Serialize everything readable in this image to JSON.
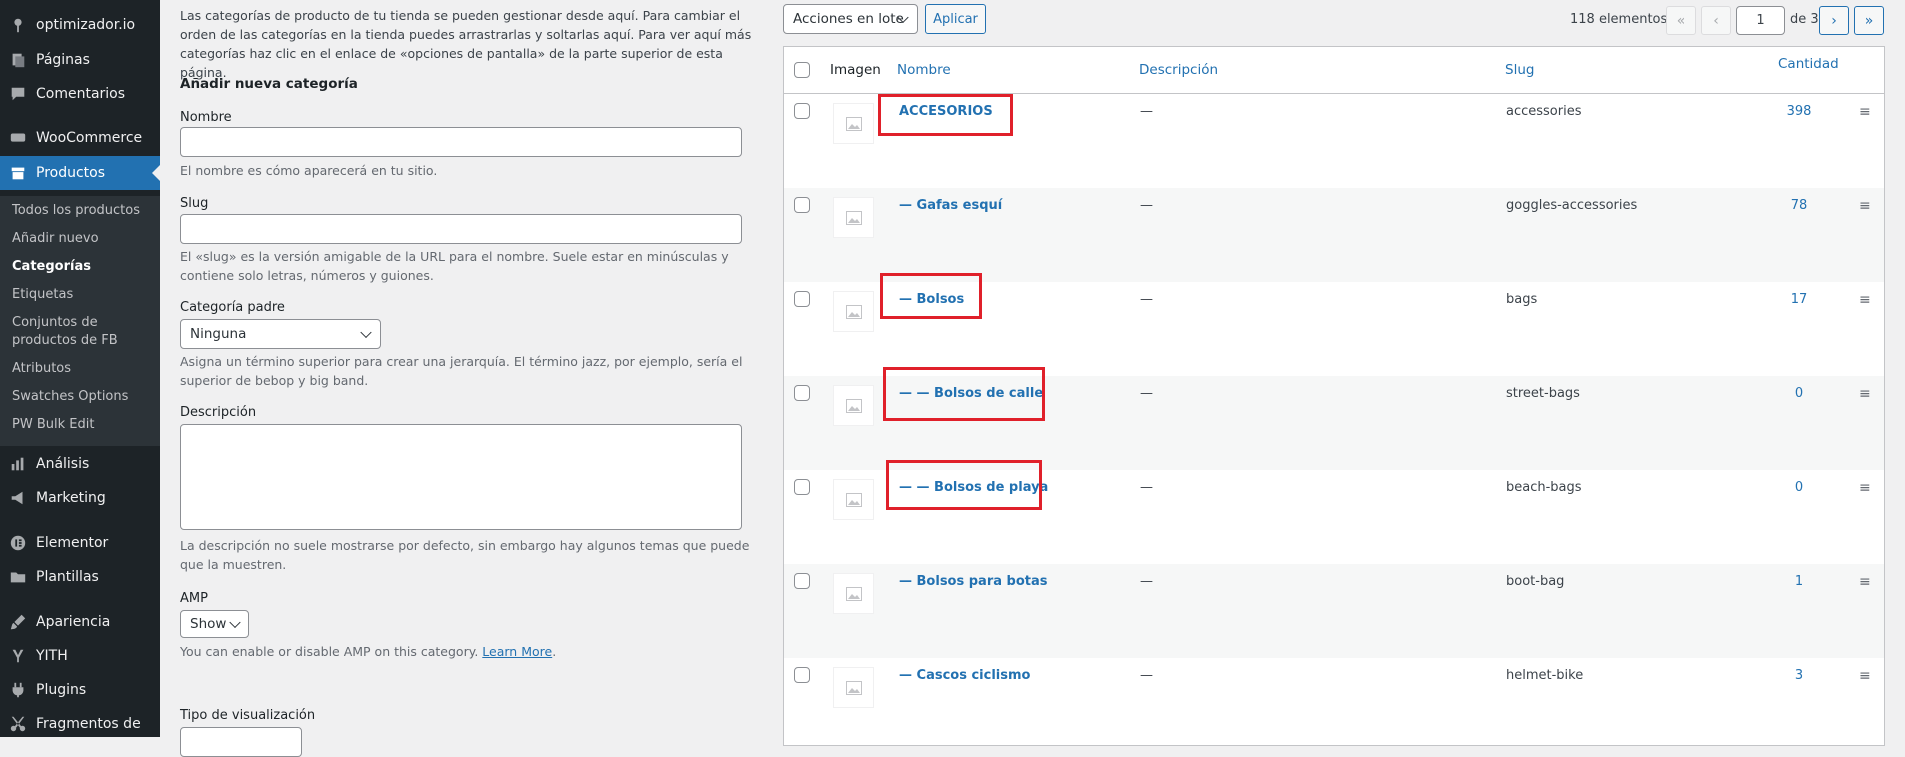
{
  "sidebar": {
    "items": [
      {
        "label": "optimizador.io",
        "icon": "pin-icon"
      },
      {
        "label": "Páginas",
        "icon": "pages-icon"
      },
      {
        "label": "Comentarios",
        "icon": "comment-icon"
      },
      {
        "label": "WooCommerce",
        "icon": "woo-icon"
      },
      {
        "label": "Productos",
        "icon": "archive-icon"
      },
      {
        "label": "Análisis",
        "icon": "bar-chart-icon"
      },
      {
        "label": "Marketing",
        "icon": "megaphone-icon"
      },
      {
        "label": "Elementor",
        "icon": "elementor-icon"
      },
      {
        "label": "Plantillas",
        "icon": "folder-icon"
      },
      {
        "label": "Apariencia",
        "icon": "brush-icon"
      },
      {
        "label": "YITH",
        "icon": "yith-icon"
      },
      {
        "label": "Plugins",
        "icon": "plug-icon"
      },
      {
        "label": "Fragmentos de",
        "icon": "scissors-icon"
      }
    ],
    "submenu": [
      {
        "label": "Todos los productos"
      },
      {
        "label": "Añadir nuevo"
      },
      {
        "label": "Categorías",
        "current": true
      },
      {
        "label": "Etiquetas"
      },
      {
        "label": "Conjuntos de productos de FB"
      },
      {
        "label": "Atributos"
      },
      {
        "label": "Swatches Options"
      },
      {
        "label": "PW Bulk Edit"
      }
    ]
  },
  "form": {
    "intro": "Las categorías de producto de tu tienda se pueden gestionar desde aquí. Para cambiar el orden de las categorías en la tienda puedes arrastrarlas y soltarlas aquí. Para ver aquí más categorías haz clic en el enlace de «opciones de pantalla» de la parte superior de esta página.",
    "heading": "Añadir nueva categoría",
    "name_label": "Nombre",
    "name_help": "El nombre es cómo aparecerá en tu sitio.",
    "slug_label": "Slug",
    "slug_help": "El «slug» es la versión amigable de la URL para el nombre. Suele estar en minúsculas y contiene solo letras, números y guiones.",
    "parent_label": "Categoría padre",
    "parent_value": "Ninguna",
    "parent_help": "Asigna un término superior para crear una jerarquía. El término jazz, por ejemplo, sería el superior de bebop y big band.",
    "description_label": "Descripción",
    "description_help": "La descripción no suele mostrarse por defecto, sin embargo hay algunos temas que puede que la muestren.",
    "amp_label": "AMP",
    "amp_value": "Show",
    "amp_help": "You can enable or disable AMP on this category.",
    "amp_link": "Learn More",
    "amp_help_end": ".",
    "display_type_label": "Tipo de visualización"
  },
  "toolbar": {
    "bulk_action": "Acciones en lote",
    "apply": "Aplicar",
    "items_count": "118 elementos",
    "first": "«",
    "prev": "‹",
    "current_page": "1",
    "of_pages": "de 3",
    "next": "›",
    "last": "»"
  },
  "table": {
    "headers": {
      "image": "Imagen",
      "name": "Nombre",
      "description": "Descripción",
      "slug": "Slug",
      "count": "Cantidad"
    },
    "rows": [
      {
        "name": "ACCESORIOS",
        "desc": "—",
        "slug": "accessories",
        "count": "398"
      },
      {
        "name": "— Gafas esquí",
        "desc": "—",
        "slug": "goggles-accessories",
        "count": "78"
      },
      {
        "name": "— Bolsos",
        "desc": "—",
        "slug": "bags",
        "count": "17"
      },
      {
        "name": "— — Bolsos de calle",
        "desc": "—",
        "slug": "street-bags",
        "count": "0"
      },
      {
        "name": "— — Bolsos de playa",
        "desc": "—",
        "slug": "beach-bags",
        "count": "0"
      },
      {
        "name": "— Bolsos para botas",
        "desc": "—",
        "slug": "boot-bag",
        "count": "1"
      },
      {
        "name": "— Cascos ciclismo",
        "desc": "—",
        "slug": "helmet-bike",
        "count": "3"
      }
    ],
    "handle_glyph": "≡"
  },
  "colors": {
    "sidebar": "#1d2327",
    "accent": "#2271b1",
    "highlight": "#e0202a"
  }
}
